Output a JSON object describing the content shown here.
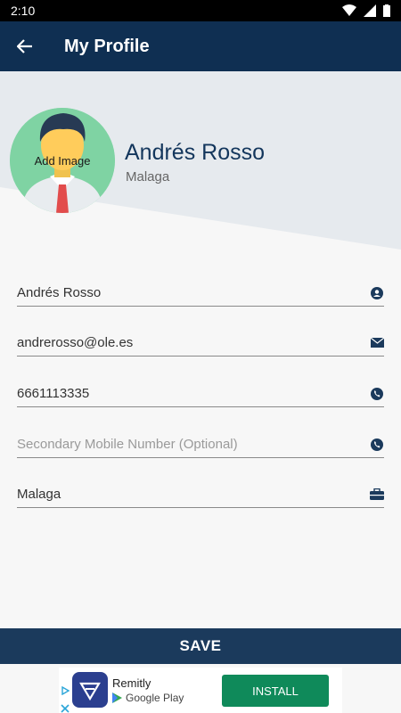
{
  "status_bar": {
    "time": "2:10"
  },
  "app_bar": {
    "title": "My Profile"
  },
  "profile": {
    "avatar_label": "Add Image",
    "name": "Andrés Rosso",
    "city": "Malaga"
  },
  "form": {
    "fields": [
      {
        "value": "Andrés Rosso",
        "placeholder": "",
        "icon": "person-icon"
      },
      {
        "value": "andrerosso@ole.es",
        "placeholder": "",
        "icon": "mail-icon"
      },
      {
        "value": "6661113335",
        "placeholder": "",
        "icon": "phone-icon"
      },
      {
        "value": "",
        "placeholder": "Secondary Mobile Number (Optional)",
        "icon": "phone-icon"
      },
      {
        "value": "Malaga",
        "placeholder": "",
        "icon": "briefcase-icon"
      }
    ]
  },
  "save_label": "SAVE",
  "ad": {
    "app_name": "Remitly",
    "store": "Google Play",
    "install_label": "INSTALL",
    "accent": "#0f8a5a"
  },
  "colors": {
    "app_bar": "#0f2f52",
    "save_bar": "#1b3a5c",
    "name": "#13365c"
  }
}
